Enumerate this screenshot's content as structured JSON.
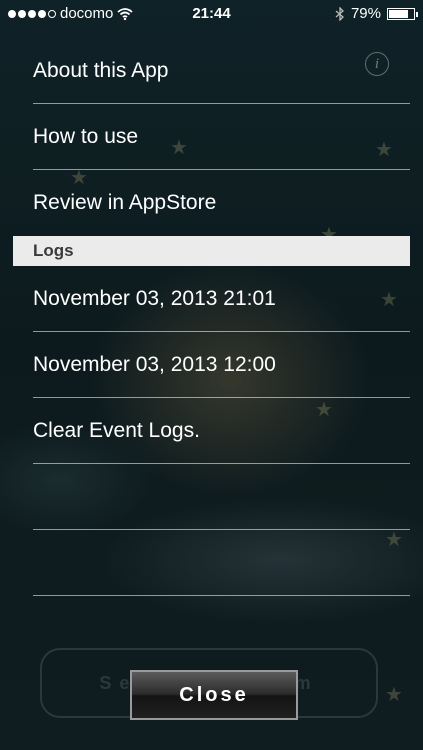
{
  "status_bar": {
    "carrier": "docomo",
    "time": "21:44",
    "battery": "79%",
    "battery_level": 0.79,
    "signal_bars": 4
  },
  "menu": {
    "items": [
      {
        "label": "About this App"
      },
      {
        "label": "How to use"
      },
      {
        "label": "Review in AppStore"
      }
    ],
    "logs_header": "Logs",
    "logs": [
      {
        "label": "November 03, 2013 21:01"
      },
      {
        "label": "November 03, 2013 12:00"
      },
      {
        "label": "Clear Event Logs."
      },
      {
        "label": ""
      },
      {
        "label": ""
      }
    ]
  },
  "background_button": "Set the Alarm",
  "close_label": "Close",
  "info_icon": "info-icon",
  "colors": {
    "section_header_bg": "#ebebeb",
    "background": "#13262a"
  }
}
